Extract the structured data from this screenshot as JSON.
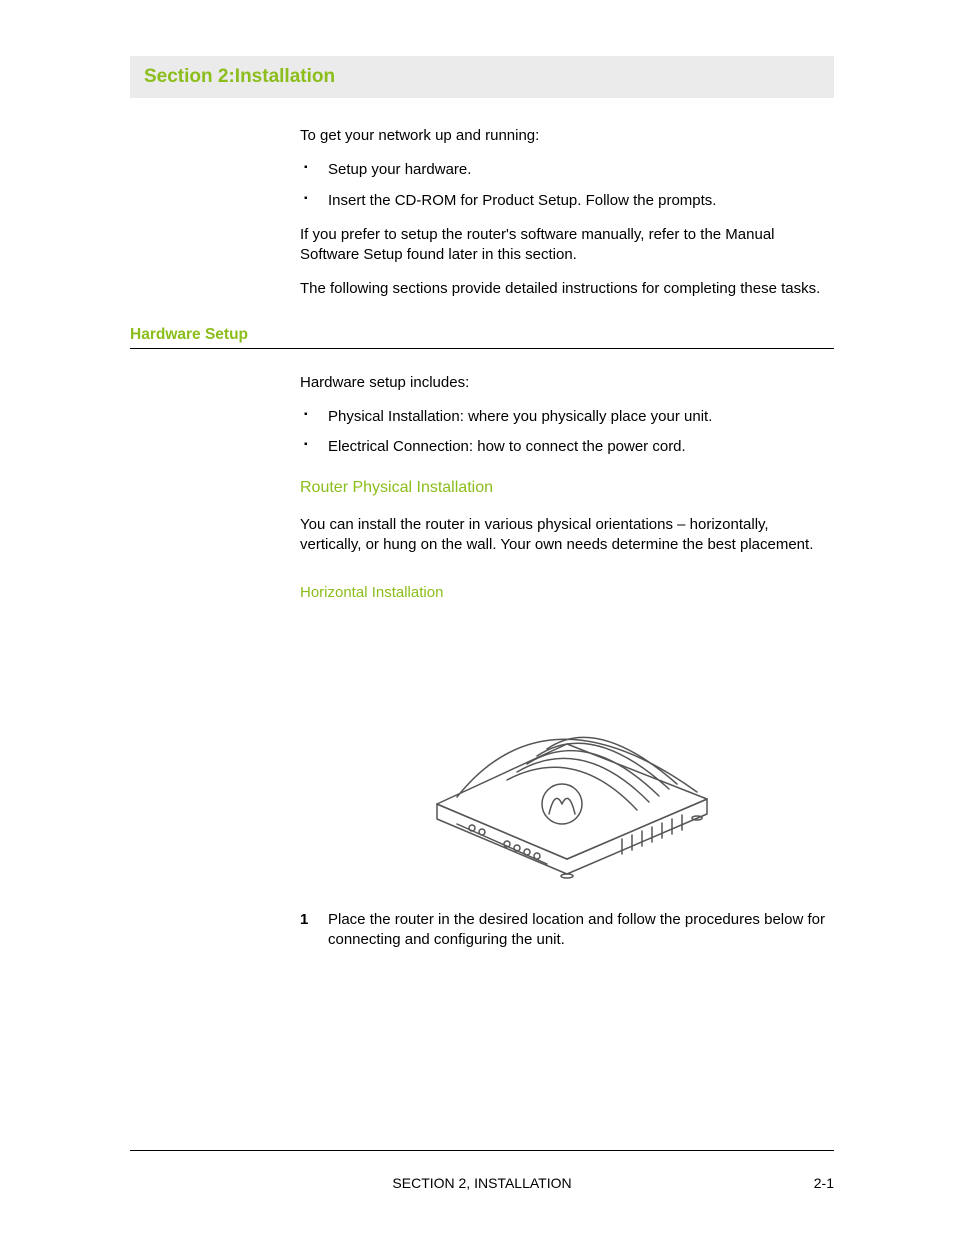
{
  "section_title": "Section 2:Installation",
  "intro": {
    "lead": "To get your network up and running:",
    "bullets": [
      "Setup your hardware.",
      "Insert the CD-ROM for Product Setup. Follow the prompts."
    ],
    "para2": "If you prefer to setup the router's software manually, refer to the Manual Software Setup found later in this section.",
    "para3": "The following sections provide detailed instructions for completing these tasks."
  },
  "hardware": {
    "heading": "Hardware Setup",
    "lead": "Hardware setup includes:",
    "bullets": [
      "Physical Installation: where you physically place your unit.",
      "Electrical Connection: how to connect the power cord."
    ],
    "sub1_heading": "Router Physical Installation",
    "sub1_para": "You can install the router in various physical orientations – horizontally, vertically, or hung on the wall. Your own needs determine the best placement.",
    "sub2_heading": "Horizontal Installation",
    "step1_num": "1",
    "step1_text": "Place the router in the desired location and follow the procedures below for connecting and configuring the unit."
  },
  "footer": {
    "title": "SECTION 2, INSTALLATION",
    "page": "2-1"
  }
}
